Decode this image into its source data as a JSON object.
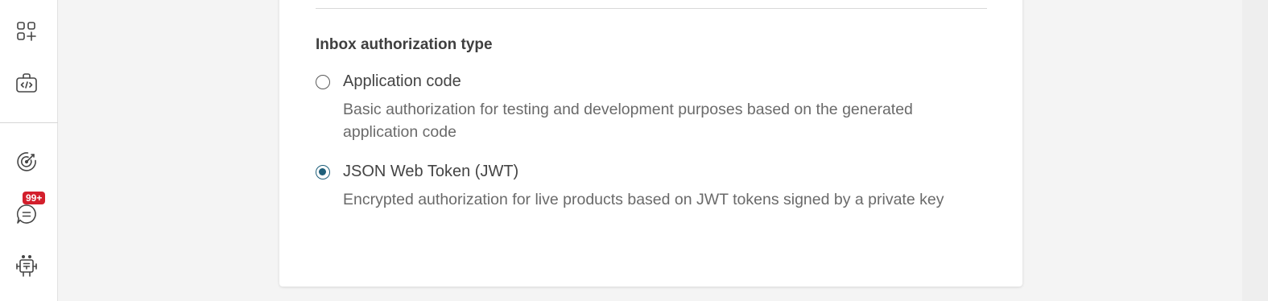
{
  "sidebar": {
    "icons": [
      {
        "name": "apps-add-icon"
      },
      {
        "name": "developer-toolbox-icon"
      },
      {
        "name": "target-icon"
      },
      {
        "name": "chat-icon"
      },
      {
        "name": "bot-icon"
      }
    ],
    "chat_badge": "99+"
  },
  "form": {
    "section_title": "Inbox authorization type",
    "options": [
      {
        "label": "Application code",
        "description": "Basic authorization for testing and development purposes based on the generated application code",
        "selected": false
      },
      {
        "label": "JSON Web Token (JWT)",
        "description": "Encrypted authorization for live products based on JWT tokens signed by a private key",
        "selected": true
      }
    ]
  },
  "colors": {
    "accent": "#1f5f7a",
    "badge": "#d31f2c",
    "background": "#f4f4f4",
    "card": "#ffffff"
  }
}
